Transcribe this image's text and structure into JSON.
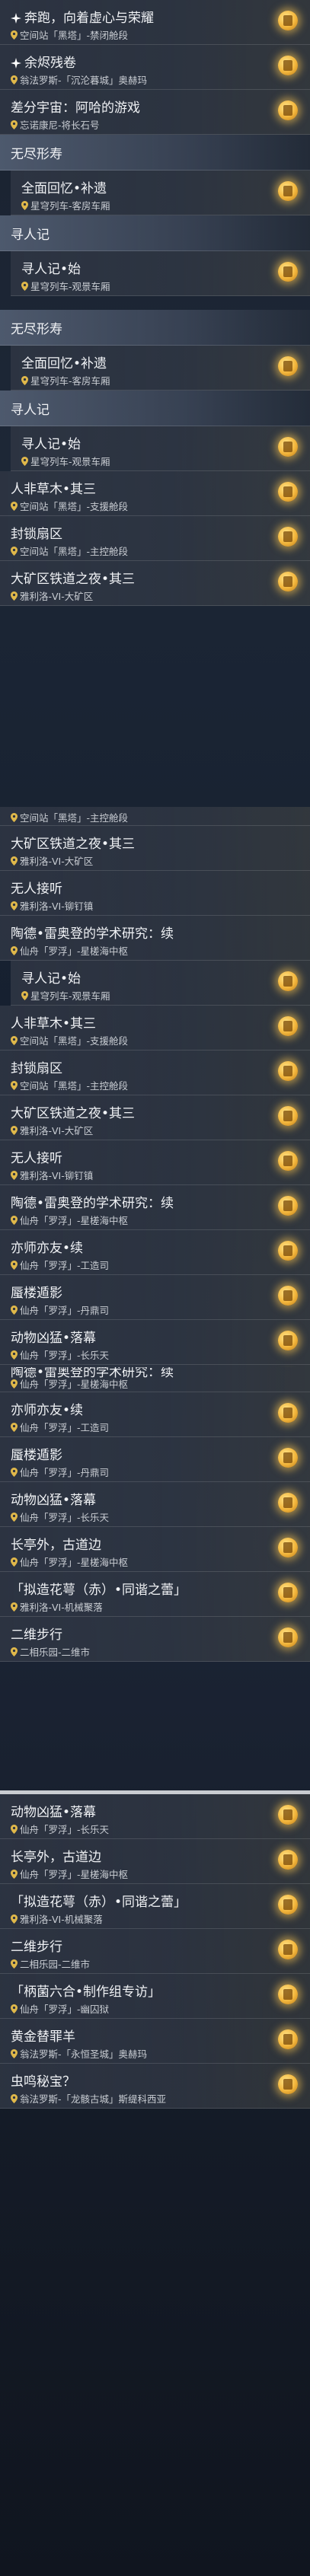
{
  "blocks": [
    {
      "type": "quest",
      "title": "奔跑，向着虚心与荣耀",
      "location": "空间站「黑塔」-禁闭舱段",
      "icon": "spark"
    },
    {
      "type": "quest",
      "title": "余烬残卷",
      "location": "翁法罗斯-「沉沦暮城」奥赫玛",
      "icon": "spark"
    },
    {
      "type": "quest",
      "title": "差分宇宙：阿哈的游戏",
      "location": "忘诺康尼-将长石号"
    },
    {
      "type": "header",
      "title": "无尽形寿"
    },
    {
      "type": "quest",
      "title": "全面回忆•补遗",
      "location": "星穹列车-客房车厢",
      "indent": true
    },
    {
      "type": "header",
      "title": "寻人记"
    },
    {
      "type": "quest",
      "title": "寻人记•始",
      "location": "星穹列车-观景车厢",
      "indent": true
    },
    {
      "type": "gap"
    },
    {
      "type": "header",
      "title": "无尽形寿"
    },
    {
      "type": "quest",
      "title": "全面回忆•补遗",
      "location": "星穹列车-客房车厢",
      "indent": true
    },
    {
      "type": "header",
      "title": "寻人记"
    },
    {
      "type": "quest",
      "title": "寻人记•始",
      "location": "星穹列车-观景车厢",
      "indent": true
    },
    {
      "type": "quest",
      "title": "人非草木•其三",
      "location": "空间站「黑塔」-支援舱段"
    },
    {
      "type": "quest",
      "title": "封锁扇区",
      "location": "空间站「黑塔」-主控舱段"
    },
    {
      "type": "quest",
      "title": "大矿区铁道之夜•其三",
      "location": "雅利洛-VI-大矿区"
    }
  ],
  "blocks2": [
    {
      "type": "quest",
      "title": "寻人记•始",
      "location": "星穹列车-观景车厢",
      "indent": true
    },
    {
      "type": "quest",
      "title": "人非草木•其三",
      "location": "空间站「黑塔」-支援舱段"
    },
    {
      "type": "quest",
      "title": "封锁扇区",
      "location": "空间站「黑塔」-主控舱段"
    },
    {
      "type": "quest",
      "title": "大矿区铁道之夜•其三",
      "location": "雅利洛-VI-大矿区"
    },
    {
      "type": "quest",
      "title": "无人接听",
      "location": "雅利洛-VI-铆钉镇"
    },
    {
      "type": "quest",
      "title": "陶德•雷奥登的学术研究：续",
      "location": "仙舟「罗浮」-星槎海中枢"
    },
    {
      "type": "quest",
      "title": "亦师亦友•续",
      "location": "仙舟「罗浮」-工造司"
    },
    {
      "type": "quest",
      "title": "蜃楼遁影",
      "location": "仙舟「罗浮」-丹鼎司"
    },
    {
      "type": "quest",
      "title": "动物凶猛•落幕",
      "location": "仙舟「罗浮」-长乐天"
    },
    {
      "type": "quest",
      "title": "长亭外，古道边",
      "location": "仙舟「罗浮」-星槎海中枢"
    }
  ],
  "blocks3": [
    {
      "type": "quest",
      "title": "亦师亦友•续",
      "location": "仙舟「罗浮」-工造司"
    },
    {
      "type": "quest",
      "title": "蜃楼遁影",
      "location": "仙舟「罗浮」-丹鼎司"
    },
    {
      "type": "quest",
      "title": "动物凶猛•落幕",
      "location": "仙舟「罗浮」-长乐天"
    },
    {
      "type": "quest",
      "title": "长亭外，古道边",
      "location": "仙舟「罗浮」-星槎海中枢"
    },
    {
      "type": "quest",
      "title": "「拟造花萼（赤）•同谐之蕾」",
      "location": "雅利洛-VI-机械聚落"
    },
    {
      "type": "quest",
      "title": "二维步行",
      "location": "二相乐园-二维市"
    }
  ],
  "blocks4": [
    {
      "type": "quest",
      "title": "动物凶猛•落幕",
      "location": "仙舟「罗浮」-长乐天"
    },
    {
      "type": "quest",
      "title": "长亭外，古道边",
      "location": "仙舟「罗浮」-星槎海中枢"
    },
    {
      "type": "quest",
      "title": "「拟造花萼（赤）•同谐之蕾」",
      "location": "雅利洛-VI-机械聚落"
    },
    {
      "type": "quest",
      "title": "二维步行",
      "location": "二相乐园-二维市"
    },
    {
      "type": "quest",
      "title": "「柄菌六合•制作组专访」",
      "location": "仙舟「罗浮」-幽囚狱"
    },
    {
      "type": "quest",
      "title": "黄金替罪羊",
      "location": "翁法罗斯-「永恒圣城」奥赫玛"
    },
    {
      "type": "quest",
      "title": "虫鸣秘宝？",
      "location": "翁法罗斯-「龙骸古城」斯缇科西亚"
    }
  ],
  "partials": {
    "dup_loc_1": "空间站「黑塔」-主控舱段",
    "dup_title_1": "大矿区铁道之夜•其三",
    "dup_loc_2": "雅利洛-VI-大矿区",
    "dup_title_2": "无人接听",
    "dup_loc_3": "雅利洛-VI-铆钉镇",
    "dup_title_3": "陶德•雷奥登的学术研究：续",
    "dup_loc_4": "仙舟「罗浮」-星槎海中枢",
    "cut_top_1": "陶德•雷奥登的学术研究：续",
    "cut_loc_1": "仙舟「罗浮」-星槎海中枢",
    "cut_title_2": "二维步行",
    "cut_loc_2": "二相乐园-二维市"
  },
  "colors": {
    "accent": "#f3b63c",
    "text": "#f0f2f5",
    "sub": "#c9cdd3",
    "header_bg": "#505c70"
  }
}
